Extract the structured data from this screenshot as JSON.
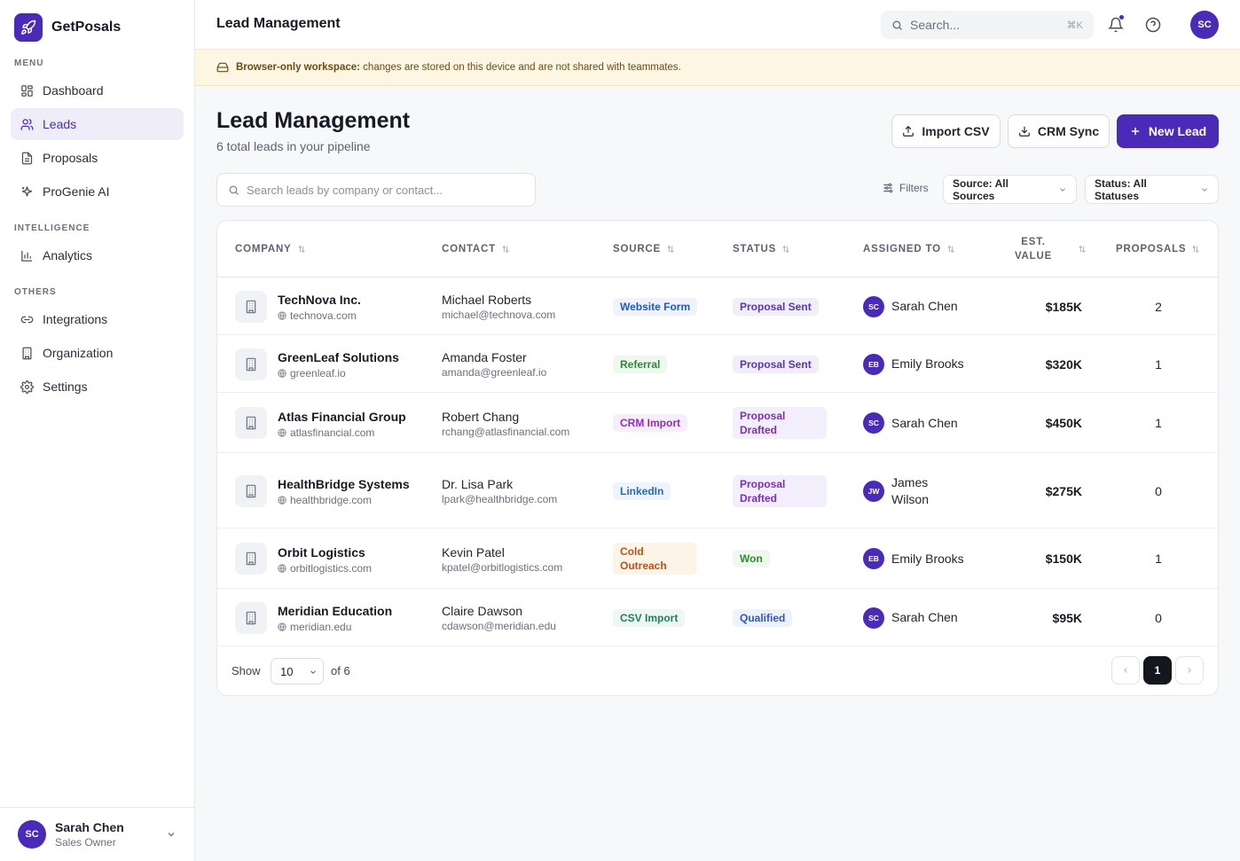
{
  "app": {
    "name": "GetPosals"
  },
  "sidebar": {
    "sections": [
      {
        "label": "MENU",
        "items": [
          {
            "label": "Dashboard",
            "icon": "dashboard-icon"
          },
          {
            "label": "Leads",
            "icon": "users-icon",
            "active": true
          },
          {
            "label": "Proposals",
            "icon": "document-icon"
          },
          {
            "label": "ProGenie AI",
            "icon": "sparkle-icon"
          }
        ]
      },
      {
        "label": "INTELLIGENCE",
        "items": [
          {
            "label": "Analytics",
            "icon": "bar-chart-icon"
          }
        ]
      },
      {
        "label": "OTHERS",
        "items": [
          {
            "label": "Integrations",
            "icon": "link-icon"
          },
          {
            "label": "Organization",
            "icon": "building-icon"
          },
          {
            "label": "Settings",
            "icon": "gear-icon"
          }
        ]
      }
    ],
    "user": {
      "initials": "SC",
      "name": "Sarah Chen",
      "role": "Sales Owner"
    }
  },
  "topbar": {
    "title": "Lead Management",
    "search_placeholder": "Search...",
    "search_shortcut": "⌘K",
    "avatar_initials": "SC"
  },
  "banner": {
    "bold": "Browser-only workspace:",
    "text": "changes are stored on this device and are not shared with teammates."
  },
  "page": {
    "title": "Lead Management",
    "subtitle": "6 total leads in your pipeline",
    "buttons": {
      "import": "Import CSV",
      "crm": "CRM Sync",
      "new": "New Lead"
    },
    "search_placeholder": "Search leads by company or contact...",
    "filters_label": "Filters",
    "source_filter": "Source: All Sources",
    "status_filter": "Status: All Statuses"
  },
  "table": {
    "columns": [
      "COMPANY",
      "CONTACT",
      "SOURCE",
      "STATUS",
      "ASSIGNED TO",
      "EST. VALUE",
      "PROPOSALS"
    ],
    "rows": [
      {
        "company": "TechNova Inc.",
        "domain": "technova.com",
        "contact": "Michael Roberts",
        "email": "michael@technova.com",
        "source": "Website Form",
        "status": "Proposal Sent",
        "assignee_initials": "SC",
        "assignee": "Sarah Chen",
        "value": "$185K",
        "proposals": "2"
      },
      {
        "company": "GreenLeaf Solutions",
        "domain": "greenleaf.io",
        "contact": "Amanda Foster",
        "email": "amanda@greenleaf.io",
        "source": "Referral",
        "status": "Proposal Sent",
        "assignee_initials": "EB",
        "assignee": "Emily Brooks",
        "value": "$320K",
        "proposals": "1"
      },
      {
        "company": "Atlas Financial Group",
        "domain": "atlasfinancial.com",
        "contact": "Robert Chang",
        "email": "rchang@atlasfinancial.com",
        "source": "CRM Import",
        "status": "Proposal Drafted",
        "assignee_initials": "SC",
        "assignee": "Sarah Chen",
        "value": "$450K",
        "proposals": "1"
      },
      {
        "company": "HealthBridge Systems",
        "domain": "healthbridge.com",
        "contact": "Dr. Lisa Park",
        "email": "lpark@healthbridge.com",
        "source": "LinkedIn",
        "status": "Proposal Drafted",
        "assignee_initials": "JW",
        "assignee": "James Wilson",
        "value": "$275K",
        "proposals": "0"
      },
      {
        "company": "Orbit Logistics",
        "domain": "orbitlogistics.com",
        "contact": "Kevin Patel",
        "email": "kpatel@orbitlogistics.com",
        "source": "Cold Outreach",
        "status": "Won",
        "assignee_initials": "EB",
        "assignee": "Emily Brooks",
        "value": "$150K",
        "proposals": "1"
      },
      {
        "company": "Meridian Education",
        "domain": "meridian.edu",
        "contact": "Claire Dawson",
        "email": "cdawson@meridian.edu",
        "source": "CSV Import",
        "status": "Qualified",
        "assignee_initials": "SC",
        "assignee": "Sarah Chen",
        "value": "$95K",
        "proposals": "0"
      }
    ]
  },
  "pagination": {
    "show_label": "Show",
    "page_size": "10",
    "of_label": "of 6",
    "current_page": "1"
  },
  "colors": {
    "brand": "#4a2bb8",
    "banner_bg": "#fdf6e3"
  }
}
